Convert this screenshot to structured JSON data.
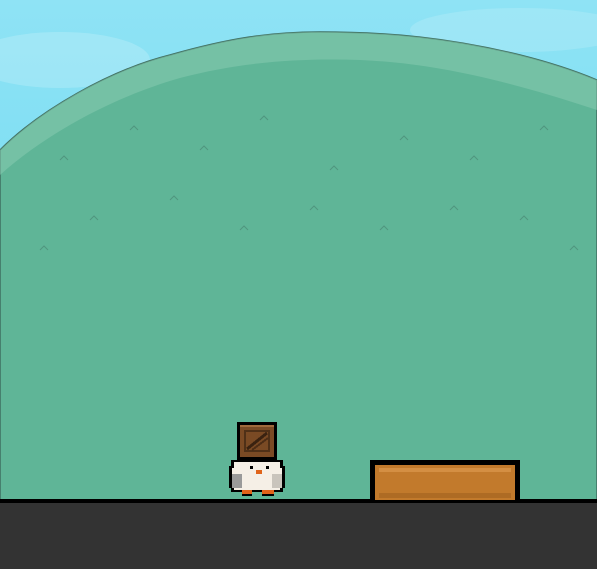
{
  "scene": {
    "sky_top_color": "#8fe3f5",
    "sky_bottom_color": "#5fd6ee",
    "hill_color": "#5fb597",
    "hill_light_color": "#86cbb0",
    "hill_outline_color": "#3f6f60",
    "ground_color": "#333333"
  },
  "player": {
    "character": "white-bird",
    "carrying": "wooden-crate",
    "body_color": "#f5efe6",
    "beak_color": "#e0641a",
    "crate_color": "#7a4a24"
  },
  "platform": {
    "kind": "crate-block",
    "color": "#c27a2c"
  }
}
